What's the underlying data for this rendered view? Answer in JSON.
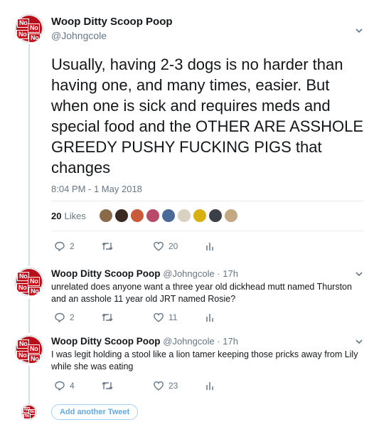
{
  "main_tweet": {
    "name": "Woop Ditty Scoop Poop",
    "handle": "@Johngcole",
    "text": "Usually, having 2-3 dogs is no harder than having one, and many times, easier. But when one is sick and requires meds and special food and the OTHER ARE ASSHOLE GREEDY PUSHY FUCKING PIGS that changes",
    "timestamp": "8:04 PM - 1 May 2018",
    "likes_count": "20",
    "likes_label": "Likes",
    "likers": [
      "#8b6a4a",
      "#3a2a22",
      "#c95a3a",
      "#b84a6a",
      "#4a6a9a",
      "#d9d2c0",
      "#d8b010",
      "#3a3f48",
      "#c4a882"
    ],
    "reply_count": "2",
    "like_count": "20"
  },
  "replies": [
    {
      "name": "Woop Ditty Scoop Poop",
      "handle_time": "@Johngcole · 17h",
      "text": "unrelated does anyone want a three year old dickhead mutt named Thurston and an asshole 11 year old JRT named Rosie?",
      "reply_count": "2",
      "like_count": "11"
    },
    {
      "name": "Woop Ditty Scoop Poop",
      "handle_time": "@Johngcole · 17h",
      "text": "I was legit holding a stool like a lion tamer keeping those pricks away from Lily while she was eating",
      "reply_count": "4",
      "like_count": "23"
    }
  ],
  "avatar_sign_text": "No",
  "add_tweet_label": "Add another Tweet",
  "colors": {
    "accent": "#1da1f2",
    "muted": "#657786",
    "thread_line": "#cfe0ee",
    "avatar_red": "#c8141f"
  }
}
